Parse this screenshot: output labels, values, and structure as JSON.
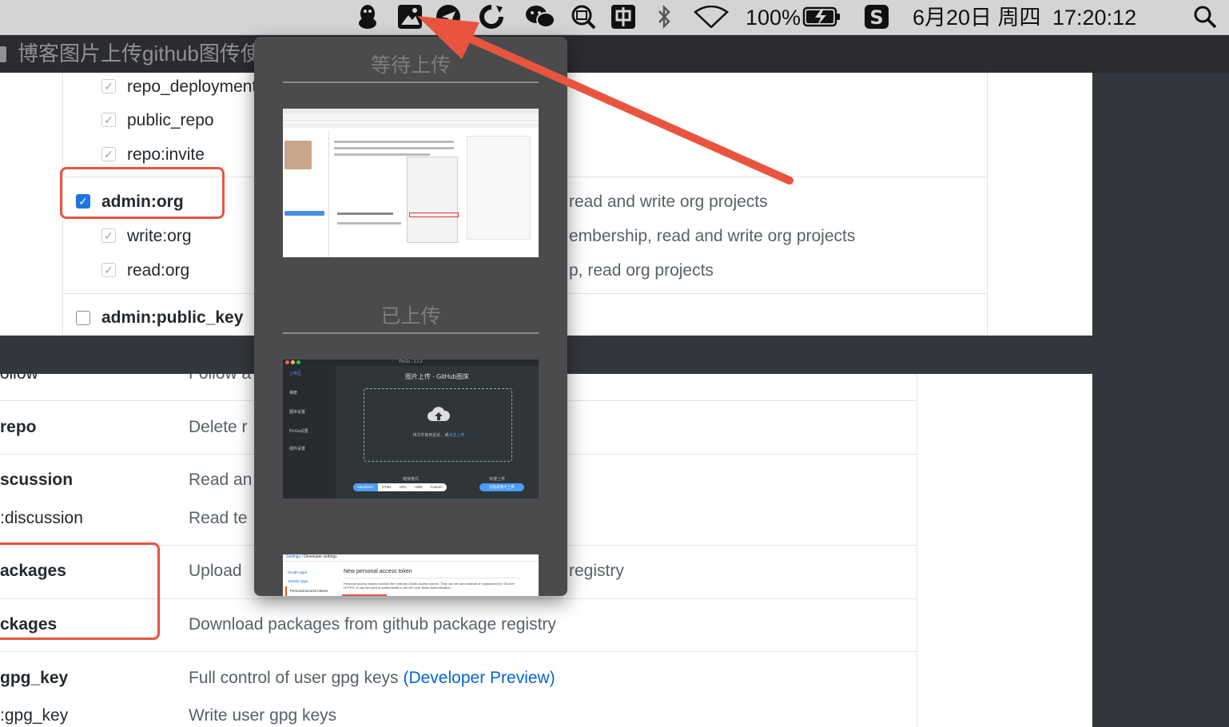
{
  "menubar": {
    "battery_percent": "100%",
    "date": "6月20日 周四",
    "time": "17:20:12",
    "icons": [
      "qq-penguin-icon",
      "picgo-icon",
      "paper-plane-icon",
      "sync-icon",
      "wechat-icon",
      "screenshot-icon",
      "input-method-icon",
      "bluetooth-icon",
      "wifi-icon",
      "battery-charging-icon",
      "sogou-icon",
      "spotlight-icon"
    ]
  },
  "tab": {
    "title": "博客图片上传github图传使"
  },
  "scopes_top": [
    {
      "name": "repo_deployment",
      "desc": ""
    },
    {
      "name": "public_repo",
      "desc": ""
    },
    {
      "name": "repo:invite",
      "desc": ""
    },
    {
      "name": "admin:org",
      "desc": "read and write org projects"
    },
    {
      "name": "write:org",
      "desc": "embership, read and write org projects"
    },
    {
      "name": "read:org",
      "desc": "p, read org projects"
    },
    {
      "name": "admin:public_key",
      "desc": ""
    }
  ],
  "scopes_bottom": [
    {
      "name": "follow",
      "desc": "Follow a"
    },
    {
      "name": "repo",
      "desc": "Delete r"
    },
    {
      "name": "scussion",
      "desc": "Read an"
    },
    {
      "name": ":discussion",
      "desc": "Read te"
    },
    {
      "name": "ackages",
      "desc": "Upload",
      "desc_tail": "registry"
    },
    {
      "name": "ckages",
      "desc": "Download packages from github package registry"
    },
    {
      "name": "gpg_key",
      "desc": "Full control of user gpg keys",
      "link": "(Developer Preview)"
    },
    {
      "name": ":gpg_key",
      "desc": "Write user gpg keys"
    }
  ],
  "popup": {
    "pending_title": "等待上传",
    "uploaded_title": "已上传",
    "thumb2": {
      "app_title": "PicGo - 2.1.2",
      "nav": [
        "上传区",
        "相册",
        "图床设置",
        "PicGo设置",
        "插件设置"
      ],
      "heading": "图片上传 - GitHub图床",
      "drop_text": "将文件拖到此处，或",
      "drop_link": "点击上传",
      "link_format": "链接格式",
      "quick_upload": "快捷上传",
      "formats": [
        "Markdown",
        "HTML",
        "URL",
        "UBB",
        "Custom"
      ],
      "clipboard_btn": "剪贴板图片上传"
    },
    "thumb3": {
      "crumb_root": "Settings",
      "crumb_leaf": "Developer settings",
      "nav": [
        "OAuth Apps",
        "GitHub Apps",
        "Personal access tokens"
      ],
      "heading": "New personal access token",
      "body": "Personal access tokens function like ordinary OAuth access tokens. They can be used instead of a password for Git over HTTPS, or can be used to authenticate to the API over Basic Authentication."
    }
  },
  "colors": {
    "accent_blue": "#1f73e6",
    "annotation_red": "#e9543f",
    "link_blue": "#0366d6"
  }
}
